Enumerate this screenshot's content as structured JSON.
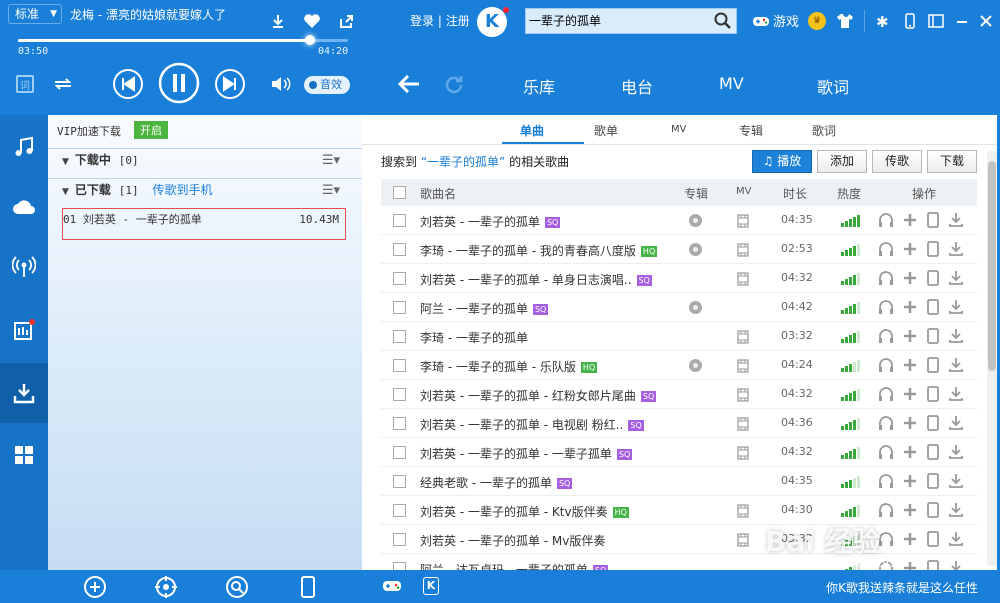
{
  "player": {
    "quality": "标准",
    "song_title": "龙梅 - 漂亮的姑娘就要嫁人了",
    "elapsed": "03:50",
    "total": "04:20",
    "progress": 0.885,
    "sound_fx": "音效"
  },
  "header": {
    "login": "登录",
    "register": "注册",
    "logo": "K",
    "search_value": "一辈子的孤单",
    "games": "游戏"
  },
  "nav_tabs": [
    "乐库",
    "电台",
    "MV",
    "歌词"
  ],
  "download_panel": {
    "vip_label": "VIP加速下载",
    "vip_button": "开启",
    "downloading": "下载中",
    "downloading_count": "[0]",
    "downloaded": "已下载",
    "downloaded_count": "[1]",
    "send_to_phone": "传歌到手机",
    "items": [
      {
        "index": "01",
        "title": "刘若英 - 一辈子的孤单",
        "size": "10.43M"
      }
    ]
  },
  "main": {
    "subtabs": [
      "单曲",
      "歌单",
      "MV",
      "专辑",
      "歌词"
    ],
    "search_prefix": "搜索到",
    "search_keyword": "“一辈子的孤单”",
    "search_suffix": "的相关歌曲",
    "actions": {
      "play": "播放",
      "add": "添加",
      "send": "传歌",
      "download": "下载"
    },
    "columns": {
      "name": "歌曲名",
      "album": "专辑",
      "mv": "MV",
      "duration": "时长",
      "heat": "热度",
      "ops": "操作"
    },
    "songs": [
      {
        "name": "刘若英 - 一辈子的孤单",
        "badge": "SQ",
        "album": true,
        "mv": true,
        "duration": "04:35",
        "heat": 5
      },
      {
        "name": "李琦 - 一辈子的孤单 - 我的青春高八度版",
        "badge": "HQ",
        "album": true,
        "mv": true,
        "duration": "02:53",
        "heat": 4
      },
      {
        "name": "刘若英 - 一辈子的孤单 - 单身日志演唱..",
        "badge": "SQ",
        "album": false,
        "mv": true,
        "duration": "04:32",
        "heat": 4
      },
      {
        "name": "阿兰 - 一辈子的孤单",
        "badge": "SQ",
        "album": true,
        "mv": false,
        "duration": "04:42",
        "heat": 4
      },
      {
        "name": "李琦 - 一辈子的孤单",
        "badge": "",
        "album": false,
        "mv": true,
        "duration": "03:32",
        "heat": 4
      },
      {
        "name": "李琦 - 一辈子的孤单 - 乐队版",
        "badge": "HQ",
        "album": true,
        "mv": true,
        "duration": "04:24",
        "heat": 3
      },
      {
        "name": "刘若英 - 一辈子的孤单 - 红粉女郎片尾曲",
        "badge": "SQ",
        "album": false,
        "mv": true,
        "duration": "04:32",
        "heat": 4
      },
      {
        "name": "刘若英 - 一辈子的孤单 - 电视剧 粉红..",
        "badge": "SQ",
        "album": false,
        "mv": true,
        "duration": "04:36",
        "heat": 4
      },
      {
        "name": "刘若英 - 一辈子的孤单 - 一辈子孤单",
        "badge": "SQ",
        "album": false,
        "mv": true,
        "duration": "04:32",
        "heat": 4
      },
      {
        "name": "经典老歌 - 一辈子的孤单",
        "badge": "SQ",
        "album": false,
        "mv": false,
        "duration": "04:35",
        "heat": 3
      },
      {
        "name": "刘若英 - 一辈子的孤单 - Ktv版伴奏",
        "badge": "HQ",
        "album": false,
        "mv": true,
        "duration": "04:30",
        "heat": 4
      },
      {
        "name": "刘若英 - 一辈子的孤单 - Mv版伴奏",
        "badge": "",
        "album": false,
        "mv": true,
        "duration": "03:32",
        "heat": 3
      },
      {
        "name": "阿兰 - 达瓦卓玛 - 一辈子的孤单",
        "badge": "SQ",
        "album": false,
        "mv": false,
        "duration": "",
        "heat": 3
      }
    ]
  },
  "bottom": {
    "marquee": "你K歌我送辣条就是这么任性",
    "watermark": "Bai 经验",
    "watermark_url": "jingyan.baidu.com"
  },
  "colors": {
    "accent": "#1a7fd8",
    "heat": "#3aa83a",
    "sq": "#a55fe0",
    "hq": "#46b448",
    "highlight_box": "#e05050"
  }
}
